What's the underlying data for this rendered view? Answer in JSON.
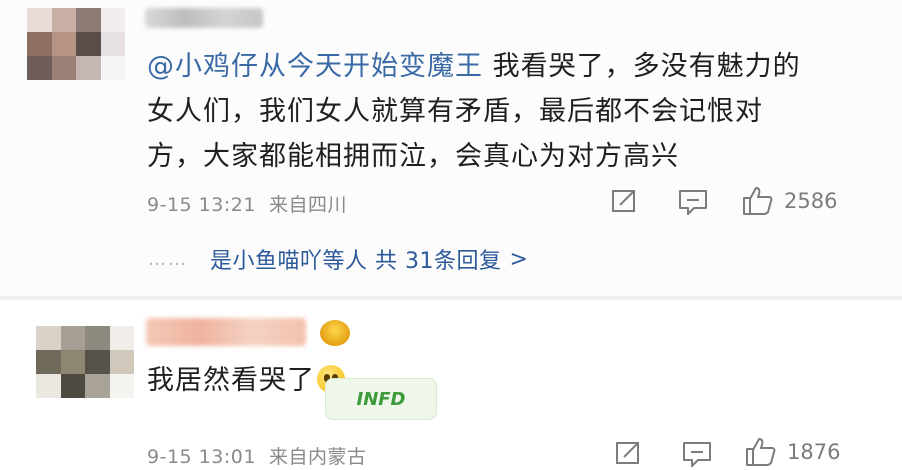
{
  "comments": [
    {
      "mention": "@小鸡仔从今天开始变魔王",
      "lines": [
        " 我看哭了，多没有魅力的",
        "女人们，我们女人就算有矛盾，最后都不会记恨对",
        "方，大家都能相拥而泣，会真心为对方高兴"
      ],
      "time": "9-15 13:21",
      "location": "来自四川",
      "like_count": "2586",
      "replies": {
        "dots": "……",
        "text": "是小鱼喵吖等人 共 31条回复",
        "arrow": ">"
      }
    },
    {
      "text": "我居然看哭了",
      "emoji": "crying-face-emoji",
      "sticker": "INFD",
      "time": "9-15 13:01",
      "location": "来自内蒙古",
      "like_count": "1876"
    }
  ],
  "icons": [
    "share-icon",
    "comment-icon",
    "like-icon"
  ],
  "colors": {
    "link": "#3a6aa6",
    "text": "#1f1f1f",
    "meta": "#8a8a8a",
    "replies": "#2d5a9a"
  }
}
